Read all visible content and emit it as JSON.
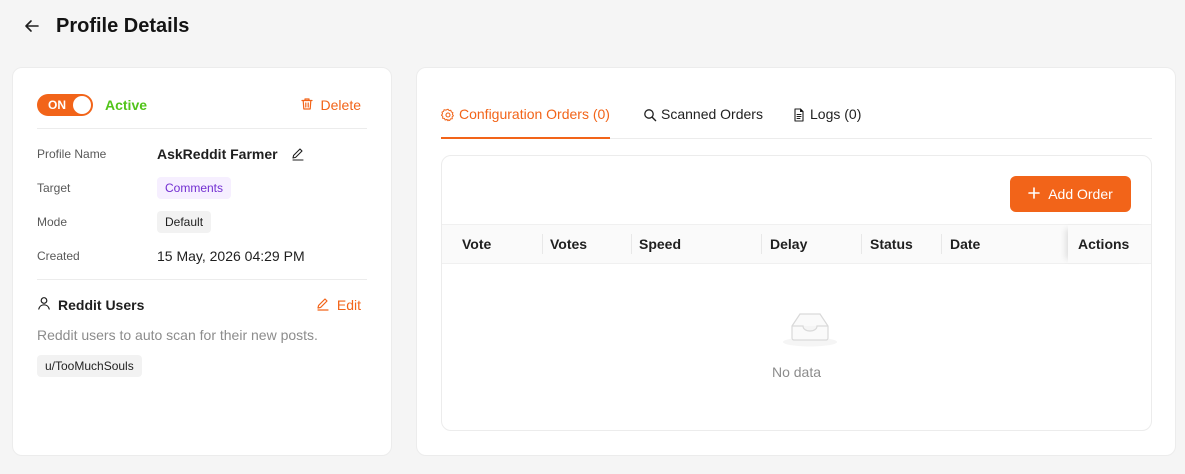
{
  "header": {
    "title": "Profile Details",
    "back_icon": "arrow-left-icon"
  },
  "profile": {
    "toggle_label": "ON",
    "status": "Active",
    "delete_label": "Delete",
    "fields": {
      "profile_name": {
        "label": "Profile Name",
        "value": "AskReddit Farmer"
      },
      "target": {
        "label": "Target",
        "value": "Comments"
      },
      "mode": {
        "label": "Mode",
        "value": "Default"
      },
      "created": {
        "label": "Created",
        "value": "15 May, 2026 04:29 PM"
      }
    }
  },
  "reddit_users": {
    "title": "Reddit Users",
    "edit_label": "Edit",
    "description": "Reddit users to auto scan for their new posts.",
    "users": [
      "u/TooMuchSouls"
    ]
  },
  "tabs": [
    {
      "label": "Configuration Orders (0)",
      "icon": "gear-icon",
      "active": true
    },
    {
      "label": "Scanned Orders",
      "icon": "search-icon",
      "active": false
    },
    {
      "label": "Logs (0)",
      "icon": "document-icon",
      "active": false
    }
  ],
  "orders": {
    "add_button_label": "Add Order",
    "columns": [
      "Vote",
      "Votes",
      "Speed",
      "Delay",
      "Status",
      "Date",
      "Actions"
    ],
    "empty_text": "No data"
  },
  "colors": {
    "accent": "#f26419",
    "active_green": "#52c41a",
    "tag_purple": "#722ed1"
  }
}
